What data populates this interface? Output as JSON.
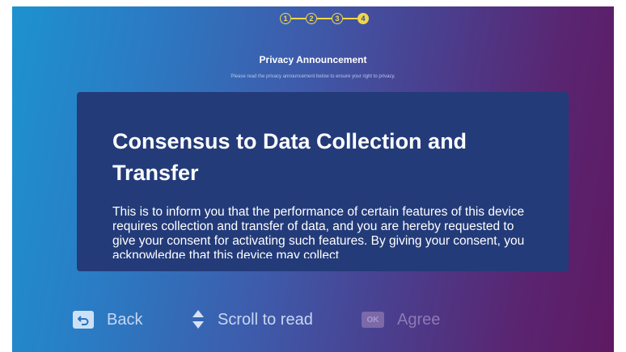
{
  "stepper": {
    "steps": [
      "1",
      "2",
      "3",
      "4"
    ],
    "current_step": 4
  },
  "header": {
    "title": "Privacy Announcement",
    "subtitle": "Please read the privacy announcement below to ensure your right to privacy."
  },
  "content": {
    "heading": "Consensus to Data Collection and Transfer",
    "body": "This is to inform you that the performance of certain features of this device requires collection and transfer of data, and you are hereby requested to give your consent for activating such features. By giving your consent, you acknowledge that this device may collect"
  },
  "footer": {
    "back": {
      "key_icon": "return-key-icon",
      "label": "Back"
    },
    "scroll": {
      "icon": "up-down-arrows-icon",
      "label": "Scroll to read"
    },
    "agree": {
      "key_label": "OK",
      "label": "Agree",
      "enabled": false
    }
  },
  "colors": {
    "accent": "#f2d64a",
    "card": "#233b79",
    "gradient_start": "#1d92cf",
    "gradient_end": "#5e1a62"
  }
}
